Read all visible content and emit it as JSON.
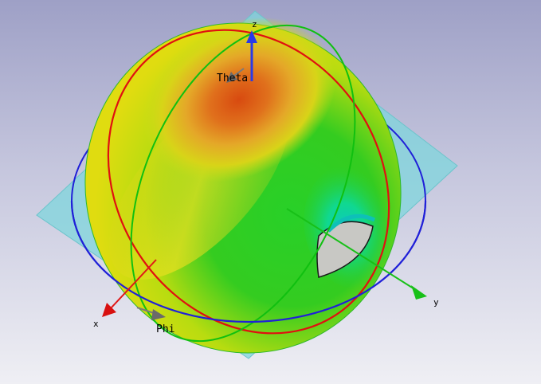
{
  "labels": {
    "z_axis": "z",
    "y_axis": "y",
    "x_axis": "x",
    "theta": "Theta",
    "phi": "Phi"
  },
  "colors": {
    "background_top": "#9ea0c6",
    "background_bottom": "#efeff4",
    "ground_plane": "#7fd6dc",
    "x_axis": "#e01818",
    "y_axis": "#18c018",
    "z_axis": "#2a3ae8",
    "theta_circle": "#e01010",
    "phi_circle": "#2020d8",
    "green_circle": "#10c010",
    "pattern_high": "#e05a10",
    "pattern_mid": "#e0e010",
    "pattern_low": "#10d010",
    "pattern_null": "#10d8a0",
    "marker_gray": "#7a7a7a"
  },
  "icons": {
    "theta_marker": "arrow-marker-icon",
    "phi_marker": "arrow-marker-icon"
  }
}
